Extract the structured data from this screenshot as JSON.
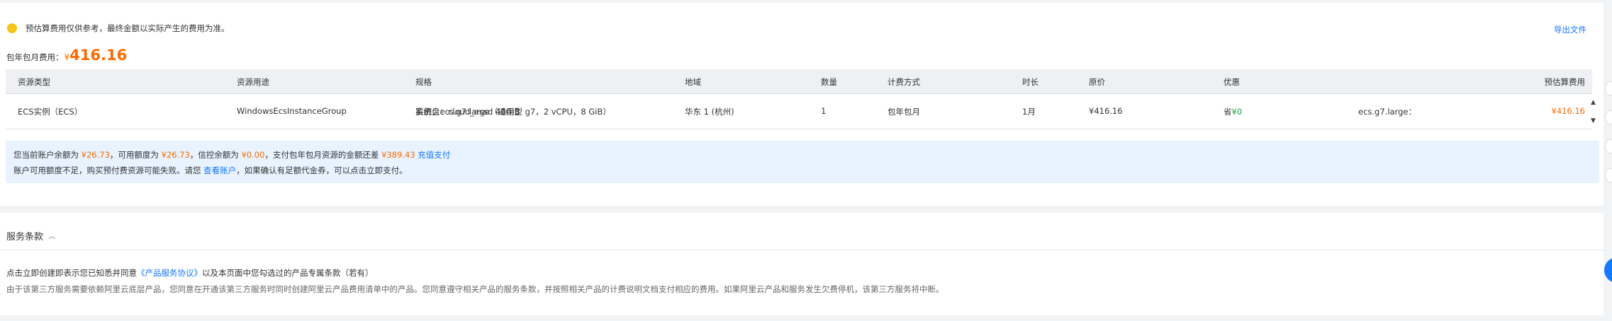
{
  "notice": {
    "text": "预估算费用仅供参考，最终金额以实际产生的费用为准。",
    "export_label": "导出文件"
  },
  "total": {
    "label": "包年包月费用：",
    "currency": "¥",
    "amount": "416.16"
  },
  "table": {
    "headers": [
      "资源类型",
      "资源用途",
      "规格",
      "地域",
      "数量",
      "计费方式",
      "时长",
      "原价",
      "优惠",
      "预估算费用"
    ],
    "row": {
      "resource_type": "ECS实例（ECS）",
      "usage": "WindowsEcsInstanceGroup",
      "spec_line1": "实例：ecs.g7.large（通用型 g7，2 vCPU，8 GiB）",
      "spec_line2": "系统盘：cloud_essd 40GiB",
      "region": "华东 1 (杭州)",
      "quantity": "1",
      "billing": "包年包月",
      "duration": "1月",
      "original_price": "¥416.16",
      "discount_prefix": "省",
      "discount_value": "¥0",
      "discount_note": "ecs.g7.large：",
      "estimated": "¥416.16"
    }
  },
  "balance": {
    "l1_a": "您当前账户余额为",
    "balance_amount": "¥26.73",
    "l1_b": "，可用额度为",
    "available_amount": "¥26.73",
    "l1_c": "，信控余额为",
    "credit_amount": "¥0.00",
    "l1_d": "，支付包年包月资源的金额还差",
    "shortfall_amount": "¥389.43",
    "recharge_link": "充值支付",
    "l2_a": "账户可用额度不足，购买预付费资源可能失败。请您",
    "view_account_link": "查看账户",
    "l2_b": "，如果确认有足额代金券，可以点击立即支付。"
  },
  "terms": {
    "title": "服务条款",
    "l1_a": "点击立即创建即表示您已知悉并同意",
    "agreement_link": "《产品服务协议》",
    "l1_b": "以及本页面中您勾选过的产品专属条款（若有）",
    "l2": "由于该第三方服务需要依赖阿里云底层产品，您同意在开通该第三方服务时同时创建阿里云产品费用清单中的产品。您同意遵守相关产品的服务条款，并按照相关产品的计费说明文档支付相应的费用。如果阿里云产品和服务发生欠费停机，该第三方服务将中断。"
  },
  "icons": {
    "warning": "warning-circle-icon",
    "terms_toggle": "chevron-up-icon",
    "scroll_up": "caret-up-icon",
    "scroll_down": "caret-down-icon"
  },
  "colors": {
    "accent": "#1677ff",
    "price": "#ff6a00",
    "discount": "#1a9f3d",
    "warning": "#f5c518",
    "info_bg": "#e8f3ff"
  }
}
